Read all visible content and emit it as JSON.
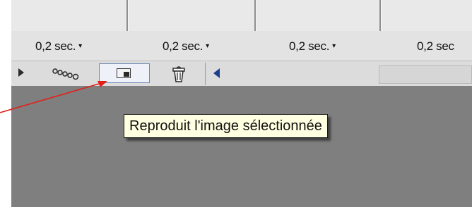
{
  "timeline": {
    "delays": [
      {
        "label": "0,2 sec."
      },
      {
        "label": "0,2 sec."
      },
      {
        "label": "0,2 sec."
      },
      {
        "label": "0,2 sec"
      }
    ],
    "caret": "▾"
  },
  "toolbar": {
    "buttons": [
      {
        "icon": "play-icon"
      },
      {
        "icon": "tween-icon"
      },
      {
        "icon": "duplicate-frame-icon"
      },
      {
        "icon": "trash-icon"
      },
      {
        "icon": "scroll-left-icon"
      }
    ]
  },
  "tooltip": {
    "text": "Reproduit l'image sélectionnée"
  },
  "colors": {
    "arrow": "#e0201b",
    "canvas": "#7f7f7f",
    "tooltip_bg": "#ffffe1",
    "button_border": "#6e86b6"
  }
}
